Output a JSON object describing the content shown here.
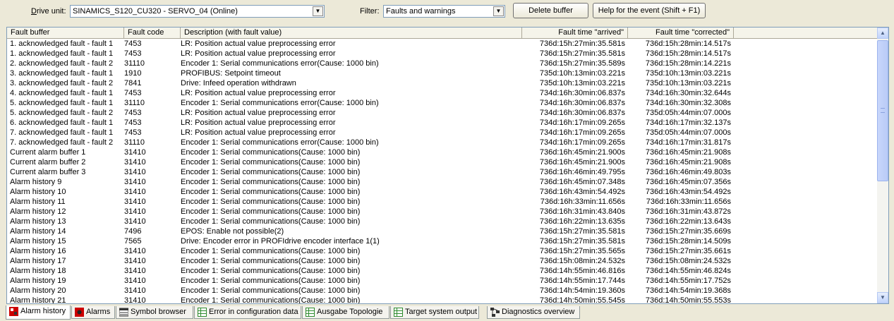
{
  "toolbar": {
    "drive_unit_label": "Drive unit:",
    "drive_unit_value": "SINAMICS_S120_CU320 - SERVO_04 (Online)",
    "filter_label": "Filter:",
    "filter_value": "Faults and warnings",
    "delete_buffer_label": "Delete buffer",
    "help_label": "Help for the event (Shift + F1)"
  },
  "table": {
    "headers": [
      "Fault buffer",
      "Fault code",
      "Description (with fault value)",
      "Fault time \"arrived\"",
      "Fault time \"corrected\""
    ],
    "rows": [
      [
        "1. acknowledged fault - fault 1",
        "7453",
        "LR: Position actual value preprocessing error",
        "736d:15h:27min:35.581s",
        "736d:15h:28min:14.517s"
      ],
      [
        "1. acknowledged fault - fault 1",
        "7453",
        "LR: Position actual value preprocessing error",
        "736d:15h:27min:35.581s",
        "736d:15h:28min:14.517s"
      ],
      [
        "2. acknowledged fault - fault 2",
        "31110",
        "Encoder 1: Serial communications error(Cause:   1000 bin)",
        "736d:15h:27min:35.589s",
        "736d:15h:28min:14.221s"
      ],
      [
        "3. acknowledged fault - fault 1",
        "1910",
        "PROFIBUS: Setpoint timeout",
        "735d:10h:13min:03.221s",
        "735d:10h:13min:03.221s"
      ],
      [
        "3. acknowledged fault - fault 2",
        "7841",
        "Drive: Infeed operation withdrawn",
        "735d:10h:13min:03.221s",
        "735d:10h:13min:03.221s"
      ],
      [
        "4. acknowledged fault - fault 1",
        "7453",
        "LR: Position actual value preprocessing error",
        "734d:16h:30min:06.837s",
        "734d:16h:30min:32.644s"
      ],
      [
        "5. acknowledged fault - fault 1",
        "31110",
        "Encoder 1: Serial communications error(Cause:   1000 bin)",
        "734d:16h:30min:06.837s",
        "734d:16h:30min:32.308s"
      ],
      [
        "5. acknowledged fault - fault 2",
        "7453",
        "LR: Position actual value preprocessing error",
        "734d:16h:30min:06.837s",
        "735d:05h:44min:07.000s"
      ],
      [
        "6. acknowledged fault - fault 1",
        "7453",
        "LR: Position actual value preprocessing error",
        "734d:16h:17min:09.265s",
        "734d:16h:17min:32.137s"
      ],
      [
        "7. acknowledged fault - fault 1",
        "7453",
        "LR: Position actual value preprocessing error",
        "734d:16h:17min:09.265s",
        "735d:05h:44min:07.000s"
      ],
      [
        "7. acknowledged fault - fault 2",
        "31110",
        "Encoder 1: Serial communications error(Cause:   1000 bin)",
        "734d:16h:17min:09.265s",
        "734d:16h:17min:31.817s"
      ],
      [
        "Current alarm buffer 1",
        "31410",
        "Encoder 1: Serial communications(Cause:   1000 bin)",
        "736d:16h:45min:21.900s",
        "736d:16h:45min:21.908s"
      ],
      [
        "Current alarm buffer 2",
        "31410",
        "Encoder 1: Serial communications(Cause:   1000 bin)",
        "736d:16h:45min:21.900s",
        "736d:16h:45min:21.908s"
      ],
      [
        "Current alarm buffer 3",
        "31410",
        "Encoder 1: Serial communications(Cause:   1000 bin)",
        "736d:16h:46min:49.795s",
        "736d:16h:46min:49.803s"
      ],
      [
        "Alarm history 9",
        "31410",
        "Encoder 1: Serial communications(Cause:   1000 bin)",
        "736d:16h:45min:07.348s",
        "736d:16h:45min:07.356s"
      ],
      [
        "Alarm history 10",
        "31410",
        "Encoder 1: Serial communications(Cause:   1000 bin)",
        "736d:16h:43min:54.492s",
        "736d:16h:43min:54.492s"
      ],
      [
        "Alarm history 11",
        "31410",
        "Encoder 1: Serial communications(Cause:   1000 bin)",
        "736d:16h:33min:11.656s",
        "736d:16h:33min:11.656s"
      ],
      [
        "Alarm history 12",
        "31410",
        "Encoder 1: Serial communications(Cause:   1000 bin)",
        "736d:16h:31min:43.840s",
        "736d:16h:31min:43.872s"
      ],
      [
        "Alarm history 13",
        "31410",
        "Encoder 1: Serial communications(Cause:   1000 bin)",
        "736d:16h:22min:13.635s",
        "736d:16h:22min:13.643s"
      ],
      [
        "Alarm history 14",
        "7496",
        "EPOS: Enable not possible(2)",
        "736d:15h:27min:35.581s",
        "736d:15h:27min:35.669s"
      ],
      [
        "Alarm history 15",
        "7565",
        "Drive: Encoder error in PROFIdrive encoder interface 1(1)",
        "736d:15h:27min:35.581s",
        "736d:15h:28min:14.509s"
      ],
      [
        "Alarm history 16",
        "31410",
        "Encoder 1: Serial communications(Cause:   1000 bin)",
        "736d:15h:27min:35.565s",
        "736d:15h:27min:35.661s"
      ],
      [
        "Alarm history 17",
        "31410",
        "Encoder 1: Serial communications(Cause:   1000 bin)",
        "736d:15h:08min:24.532s",
        "736d:15h:08min:24.532s"
      ],
      [
        "Alarm history 18",
        "31410",
        "Encoder 1: Serial communications(Cause:   1000 bin)",
        "736d:14h:55min:46.816s",
        "736d:14h:55min:46.824s"
      ],
      [
        "Alarm history 19",
        "31410",
        "Encoder 1: Serial communications(Cause:   1000 bin)",
        "736d:14h:55min:17.744s",
        "736d:14h:55min:17.752s"
      ],
      [
        "Alarm history 20",
        "31410",
        "Encoder 1: Serial communications(Cause:   1000 bin)",
        "736d:14h:54min:19.360s",
        "736d:14h:54min:19.368s"
      ],
      [
        "Alarm history 21",
        "31410",
        "Encoder 1: Serial communications(Cause:   1000 bin)",
        "736d:14h:50min:55.545s",
        "736d:14h:50min:55.553s"
      ]
    ]
  },
  "tabs": [
    {
      "label": "Alarm history",
      "icon": "alarm-history-icon",
      "active": true
    },
    {
      "label": "Alarms",
      "icon": "alarms-icon",
      "active": false
    },
    {
      "label": "Symbol browser",
      "icon": "symbol-browser-icon",
      "active": false
    },
    {
      "label": "Error in configuration data",
      "icon": "table-icon",
      "active": false
    },
    {
      "label": "Ausgabe Topologie",
      "icon": "table-icon",
      "active": false
    },
    {
      "label": "Target system output",
      "icon": "table-icon",
      "active": false
    },
    {
      "label": "Diagnostics overview",
      "icon": "diagnostics-icon",
      "active": false
    }
  ],
  "colors": {
    "accent_red": "#cc0000",
    "table_icon_green": "#2e8b2e",
    "scroll_blue": "#c1d3fb"
  }
}
